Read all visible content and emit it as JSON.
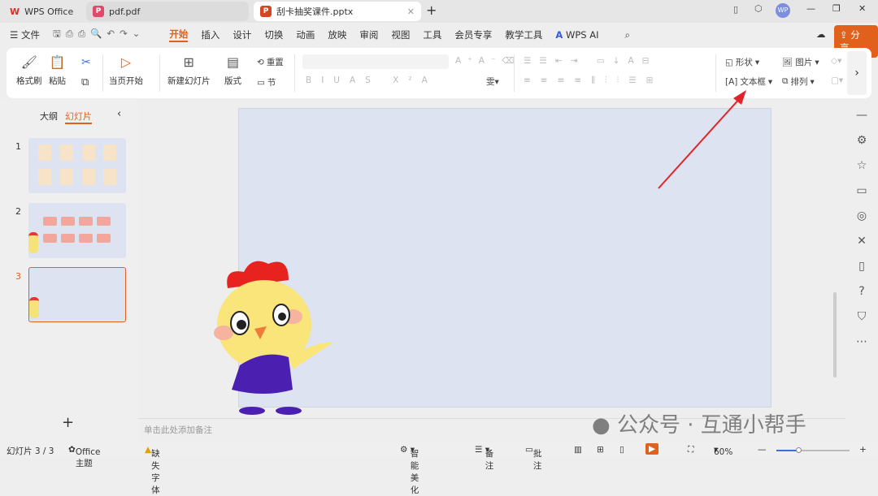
{
  "tabs": [
    {
      "label": "WPS Office",
      "icon": "wps-logo"
    },
    {
      "label": "pdf.pdf",
      "icon": "pdf-icon"
    },
    {
      "label": "刮卡抽奖课件.pptx",
      "icon": "pptx-icon",
      "active": true
    }
  ],
  "window": {
    "avatar": "WP"
  },
  "menu": {
    "file": "文件",
    "items": [
      "开始",
      "插入",
      "设计",
      "切换",
      "动画",
      "放映",
      "审阅",
      "视图",
      "工具",
      "会员专享",
      "教学工具"
    ],
    "active": "开始",
    "ai": "WPS AI",
    "share": "分享"
  },
  "ribbon": {
    "format_painter": "格式刷",
    "paste": "粘贴",
    "from_current": "当页开始",
    "new_slide": "新建幻灯片",
    "layout": "版式",
    "reset": "重置",
    "section": "节",
    "shape": "形状",
    "picture": "图片",
    "textbox": "文本框",
    "arrange": "排列"
  },
  "panel": {
    "outline": "大纲",
    "slides": "幻灯片",
    "slide_numbers": [
      "1",
      "2",
      "3"
    ],
    "selected": 3
  },
  "notes": {
    "placeholder": "单击此处添加备注"
  },
  "watermark": "公众号 · 互通小帮手",
  "status": {
    "slide": "幻灯片 3 / 3",
    "theme": "Office 主题",
    "missing_font": "缺失字体",
    "beautify": "智能美化",
    "notes": "备注",
    "comments": "批注",
    "zoom": "60%",
    "zoom_level": 60
  },
  "colors": {
    "accent": "#e0601c",
    "canvas": "#dde3f0",
    "arrow": "#e0242a"
  }
}
